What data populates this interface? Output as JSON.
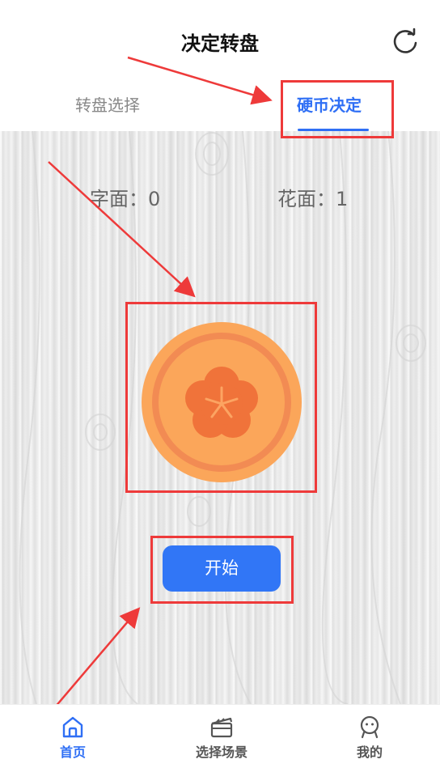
{
  "header": {
    "title": "决定转盘",
    "refresh_icon": "refresh-icon"
  },
  "tabs": [
    {
      "label": "转盘选择",
      "active": false
    },
    {
      "label": "硬币决定",
      "active": true
    }
  ],
  "scores": {
    "front_label": "字面：0",
    "back_label": "花面：1"
  },
  "coin": {
    "face": "flower",
    "colors": {
      "outer": "#FBA65A",
      "ring": "#F28B53",
      "flower": "#F0733A",
      "center": "#FCA462"
    }
  },
  "start_button": {
    "label": "开始",
    "color": "#3176F6"
  },
  "bottom_nav": {
    "items": [
      {
        "label": "首页",
        "icon": "home-icon",
        "active": true
      },
      {
        "label": "选择场景",
        "icon": "clapperboard-icon",
        "active": false
      },
      {
        "label": "我的",
        "icon": "smiley-user-icon",
        "active": false
      }
    ]
  },
  "colors": {
    "accent": "#2F6FF5",
    "annotation": "#EE3A3A",
    "muted_text": "#888888"
  }
}
